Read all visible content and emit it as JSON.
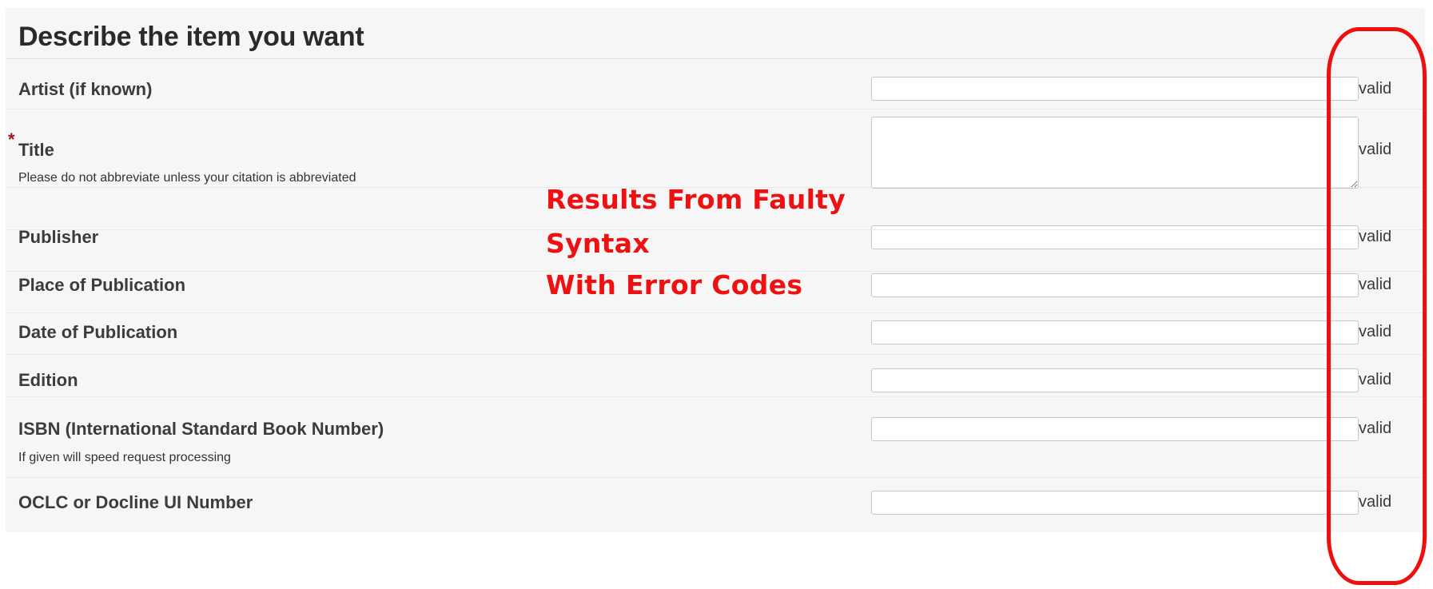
{
  "form": {
    "heading": "Describe the item you want",
    "required_marker": "*",
    "fields": [
      {
        "label": "Artist (if known)",
        "hint": "",
        "value": "",
        "status": "valid",
        "required": false,
        "multiline": false
      },
      {
        "label": "Title",
        "hint": "Please do not abbreviate unless your citation is abbreviated",
        "value": "",
        "status": "valid",
        "required": true,
        "multiline": true
      },
      {
        "label": "Publisher",
        "hint": "",
        "value": "",
        "status": "valid",
        "required": false,
        "multiline": false
      },
      {
        "label": "Place of Publication",
        "hint": "",
        "value": "",
        "status": "valid",
        "required": false,
        "multiline": false
      },
      {
        "label": "Date of Publication",
        "hint": "",
        "value": "",
        "status": "valid",
        "required": false,
        "multiline": false
      },
      {
        "label": "Edition",
        "hint": "",
        "value": "",
        "status": "valid",
        "required": false,
        "multiline": false
      },
      {
        "label": "ISBN (International Standard Book Number)",
        "hint": "If given will speed request processing",
        "value": "",
        "status": "valid",
        "required": false,
        "multiline": false
      },
      {
        "label": "OCLC or Docline UI Number",
        "hint": "",
        "value": "",
        "status": "valid",
        "required": false,
        "multiline": false
      }
    ]
  },
  "annotation": {
    "lines": [
      "Results From Faulty",
      "Syntax",
      "With Error Codes"
    ],
    "color": "#ee1111"
  },
  "colors": {
    "panel_background": "#f6f6f6",
    "label_text": "#3c3c3c",
    "required_star": "#a01818",
    "annotation_red": "#ee1111"
  }
}
